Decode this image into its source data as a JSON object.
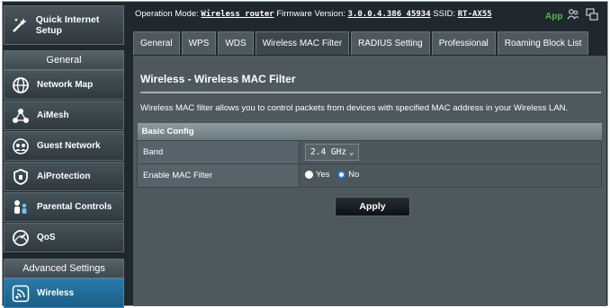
{
  "sidebar": {
    "quick_setup_label": "Quick Internet Setup",
    "general_header": "General",
    "general_items": [
      {
        "label": "Network Map",
        "icon": "globe-icon"
      },
      {
        "label": "AiMesh",
        "icon": "mesh-icon"
      },
      {
        "label": "Guest Network",
        "icon": "guest-network-icon"
      },
      {
        "label": "AiProtection",
        "icon": "shield-icon"
      },
      {
        "label": "Parental Controls",
        "icon": "parental-icon"
      },
      {
        "label": "QoS",
        "icon": "gauge-icon"
      }
    ],
    "advanced_header": "Advanced Settings",
    "advanced_items": [
      {
        "label": "Wireless",
        "icon": "wifi-icon",
        "active": true
      }
    ]
  },
  "topbar": {
    "op_mode_label": "Operation Mode:",
    "op_mode_value": "Wireless router",
    "firmware_label": "Firmware Version:",
    "firmware_value": "3.0.0.4.386_45934",
    "ssid_label": "SSID:",
    "ssid_value": "RT-AX55",
    "app_label": "App"
  },
  "tabs": [
    {
      "label": "General"
    },
    {
      "label": "WPS"
    },
    {
      "label": "WDS"
    },
    {
      "label": "Wireless MAC Filter",
      "active": true
    },
    {
      "label": "RADIUS Setting"
    },
    {
      "label": "Professional"
    },
    {
      "label": "Roaming Block List"
    }
  ],
  "page": {
    "title": "Wireless - Wireless MAC Filter",
    "description": "Wireless MAC filter allows you to control packets from devices with specified MAC address in your Wireless LAN.",
    "section_header": "Basic Config",
    "band_label": "Band",
    "band_value": "2.4 GHz",
    "mac_filter_label": "Enable MAC Filter",
    "radio_yes": "Yes",
    "radio_no": "No",
    "apply_label": "Apply"
  },
  "colors": {
    "background": "#1f282d",
    "panel": "#4d595d",
    "active_item": "#2a79a8",
    "app_link": "#54b948"
  }
}
